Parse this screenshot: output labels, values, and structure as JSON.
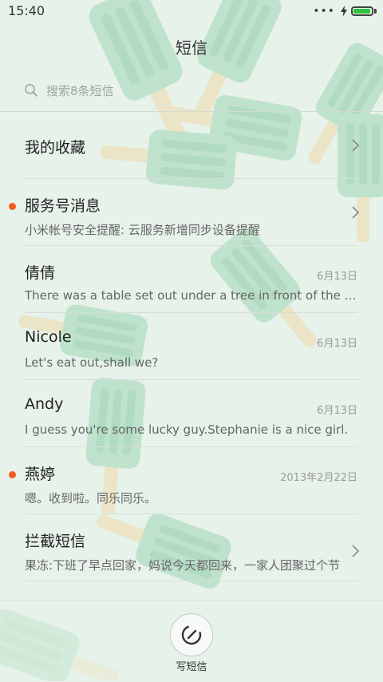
{
  "status_bar": {
    "time": "15:40",
    "signal_dots": "•••",
    "battery_level": 0.95,
    "battery_color": "#2fc23a"
  },
  "header": {
    "title": "短信"
  },
  "search": {
    "placeholder": "搜索8条短信"
  },
  "conversations": [
    {
      "title": "我的收藏",
      "snippet": "",
      "date": "",
      "unread": false,
      "chevron": true
    },
    {
      "title": "服务号消息",
      "snippet": "小米帐号安全提醒: 云服务新增同步设备提醒",
      "date": "",
      "unread": true,
      "chevron": true
    },
    {
      "title": "倩倩",
      "snippet": "There was a table set out under a tree in front of the house",
      "date": "6月13日",
      "unread": false,
      "chevron": false
    },
    {
      "title": "Nicole",
      "snippet": "Let's eat out,shall we?",
      "date": "6月13日",
      "unread": false,
      "chevron": false
    },
    {
      "title": "Andy",
      "snippet": "I guess you're some lucky guy.Stephanie is a nice girl.",
      "date": "6月13日",
      "unread": false,
      "chevron": false
    },
    {
      "title": "燕婷",
      "snippet": "嗯。收到啦。同乐同乐。",
      "date": "2013年2月22日",
      "unread": true,
      "chevron": false
    },
    {
      "title": "拦截短信",
      "snippet": "果冻:下班了早点回家，妈说今天都回来，一家人团聚过个节",
      "date": "",
      "unread": false,
      "chevron": true
    }
  ],
  "bottom": {
    "compose_label": "写短信"
  },
  "colors": {
    "background": "#e6f2ea",
    "unread_dot": "#f25d1c",
    "popsicle": "#9ed6b4",
    "popsicle_stick": "#f0d9a8"
  }
}
